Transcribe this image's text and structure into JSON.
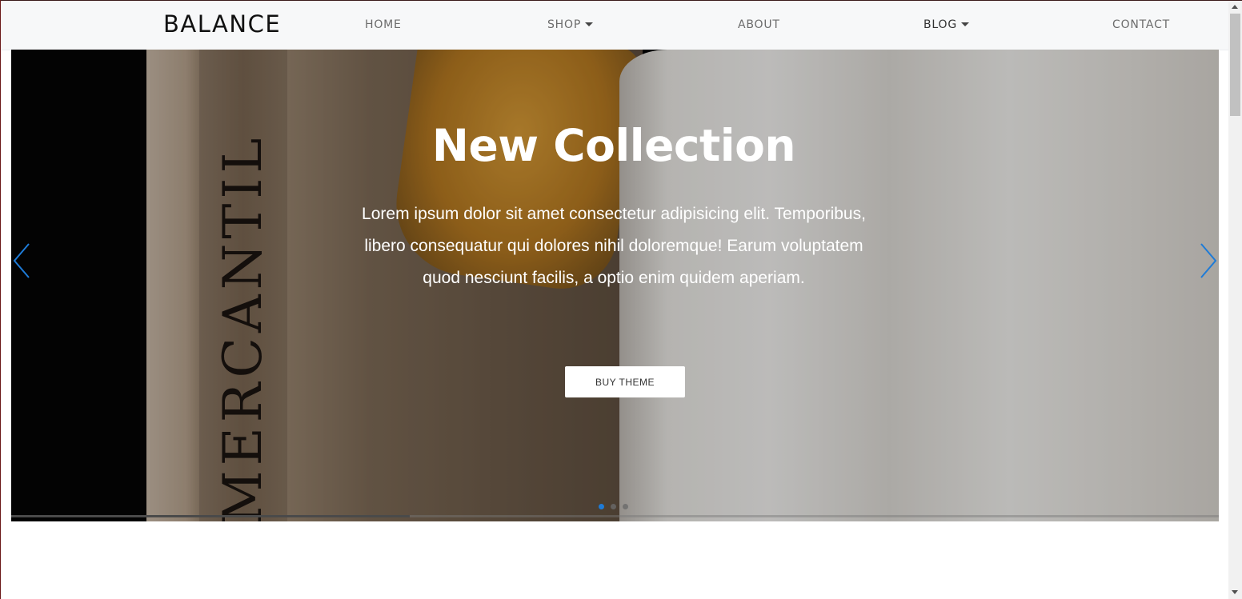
{
  "brand": "BALANCE",
  "nav": {
    "home": "HOME",
    "shop": "SHOP",
    "about": "ABOUT",
    "blog": "BLOG",
    "contact": "CONTACT"
  },
  "hero": {
    "image_text": "MERCANTIL",
    "title": "New Collection",
    "text": "Lorem ipsum dolor sit amet consectetur adipisicing elit. Temporibus, libero consequatur qui dolores nihil doloremque! Earum voluptatem quod nesciunt facilis, a optio enim quidem aperiam.",
    "button": "BUY THEME",
    "slide_count": 3,
    "active_slide": 1,
    "autoplay_progress": 0.33
  },
  "colors": {
    "accent": "#1e7bd7",
    "nav_bg": "#f7f8f9"
  },
  "icons": {
    "prev": "chevron-left-icon",
    "next": "chevron-right-icon",
    "dropdown": "caret-down-icon"
  }
}
